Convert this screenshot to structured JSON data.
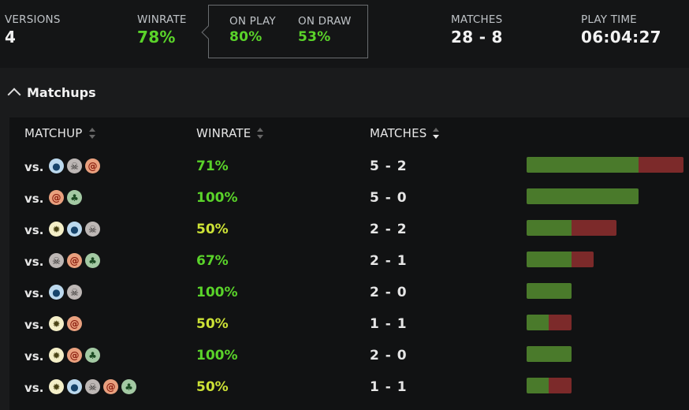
{
  "stats": {
    "versions": {
      "label": "VERSIONS",
      "value": "4"
    },
    "winrate": {
      "label": "WINRATE",
      "value": "78%"
    },
    "on_play": {
      "label": "ON PLAY",
      "value": "80%"
    },
    "on_draw": {
      "label": "ON DRAW",
      "value": "53%"
    },
    "matches": {
      "label": "MATCHES",
      "value": "28 - 8"
    },
    "play_time": {
      "label": "PLAY TIME",
      "value": "06:04:27"
    }
  },
  "section": {
    "title": "Matchups"
  },
  "table": {
    "headers": {
      "matchup": "MATCHUP",
      "winrate": "WINRATE",
      "matches": "MATCHES"
    },
    "sorted_column": "matches",
    "sort_direction": "desc",
    "vs_label": "vs.",
    "rows": [
      {
        "colors": [
          "blue",
          "black",
          "red"
        ],
        "winrate": "71%",
        "matches": "5 - 2",
        "wins": 5,
        "losses": 2,
        "tone": "green"
      },
      {
        "colors": [
          "red",
          "green"
        ],
        "winrate": "100%",
        "matches": "5 - 0",
        "wins": 5,
        "losses": 0,
        "tone": "green"
      },
      {
        "colors": [
          "white",
          "blue",
          "black"
        ],
        "winrate": "50%",
        "matches": "2 - 2",
        "wins": 2,
        "losses": 2,
        "tone": "yellow"
      },
      {
        "colors": [
          "black",
          "red",
          "green"
        ],
        "winrate": "67%",
        "matches": "2 - 1",
        "wins": 2,
        "losses": 1,
        "tone": "green"
      },
      {
        "colors": [
          "blue",
          "black"
        ],
        "winrate": "100%",
        "matches": "2 - 0",
        "wins": 2,
        "losses": 0,
        "tone": "green"
      },
      {
        "colors": [
          "white",
          "red"
        ],
        "winrate": "50%",
        "matches": "1 - 1",
        "wins": 1,
        "losses": 1,
        "tone": "yellow"
      },
      {
        "colors": [
          "white",
          "red",
          "green"
        ],
        "winrate": "100%",
        "matches": "2 - 0",
        "wins": 2,
        "losses": 0,
        "tone": "green"
      },
      {
        "colors": [
          "white",
          "blue",
          "black",
          "red",
          "green"
        ],
        "winrate": "50%",
        "matches": "1 - 1",
        "wins": 1,
        "losses": 1,
        "tone": "yellow"
      }
    ]
  },
  "colors": {
    "win_bar": "#4a7a2b",
    "loss_bar": "#7c2a2a",
    "accent_green": "#5ad32a",
    "accent_yellow": "#cde236"
  }
}
